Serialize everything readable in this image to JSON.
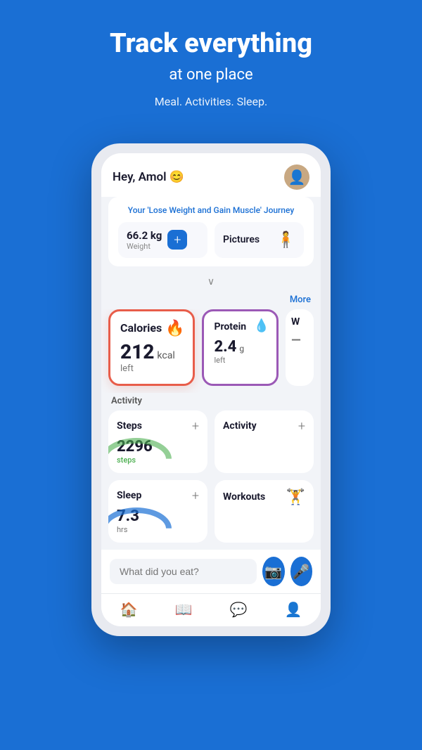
{
  "hero": {
    "title": "Track everything",
    "subtitle": "at one place",
    "tagline": "Meal. Activities. Sleep."
  },
  "app": {
    "greeting": "Hey, Amol 😊",
    "journey_title": "Your 'Lose Weight and Gain Muscle' Journey",
    "weight": {
      "value": "66.2 kg",
      "label": "Weight"
    },
    "pictures_label": "Pictures",
    "more_label": "More",
    "calories": {
      "title": "Calories",
      "value": "212",
      "unit": "kcal",
      "sub": "left"
    },
    "protein": {
      "title": "Protein",
      "value": "2.4",
      "unit": "g",
      "sub": "left"
    },
    "w_label": "W",
    "activity_section": "Activity",
    "steps": {
      "title": "Steps",
      "value": "2296",
      "unit": "steps"
    },
    "activity": {
      "title": "Activity"
    },
    "sleep": {
      "title": "Sleep",
      "value": "7.3",
      "unit": "hrs"
    },
    "workouts": {
      "title": "Workouts"
    },
    "food_input_placeholder": "What did you eat?",
    "nav": {
      "home": "🏠",
      "book": "📖",
      "chat": "💬",
      "user": "👤"
    }
  }
}
